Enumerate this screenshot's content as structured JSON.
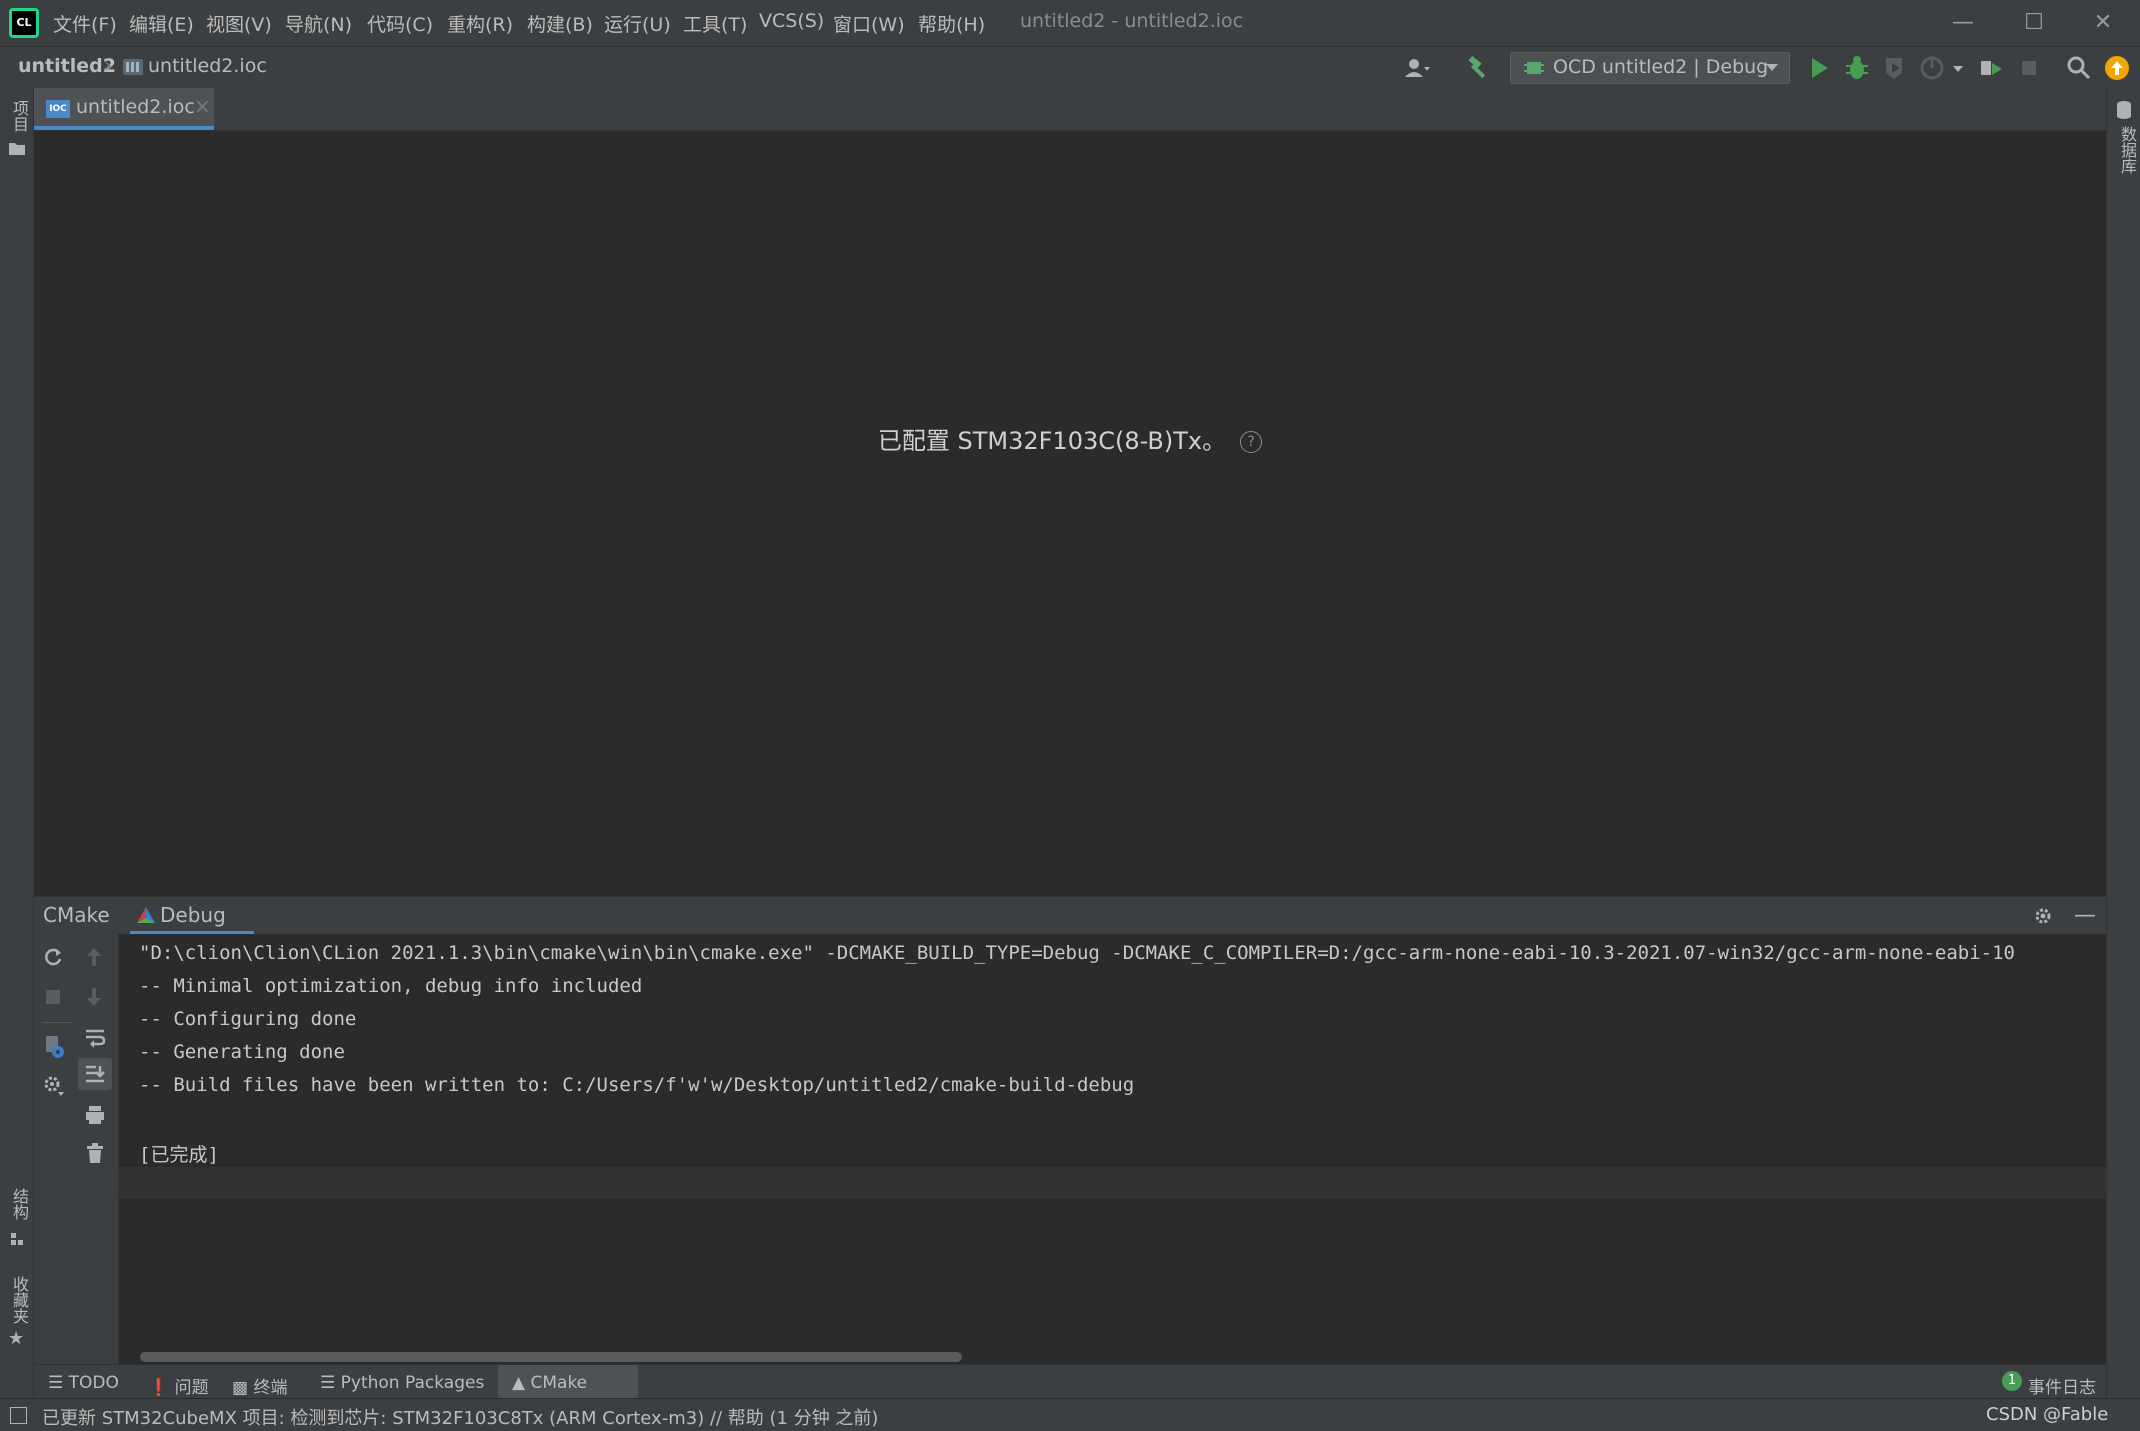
{
  "window": {
    "title": "untitled2 - untitled2.ioc",
    "app_icon_text": "CL"
  },
  "menu": [
    "文件(F)",
    "编辑(E)",
    "视图(V)",
    "导航(N)",
    "代码(C)",
    "重构(R)",
    "构建(B)",
    "运行(U)",
    "工具(T)",
    "VCS(S)",
    "窗口(W)",
    "帮助(H)"
  ],
  "navbar": {
    "project": "untitled2",
    "file": "untitled2.ioc",
    "run_config": "OCD untitled2 | Debug"
  },
  "left_stripe": {
    "project_label": "项目",
    "structure_label": "结构",
    "favorites_label": "收藏夹"
  },
  "right_stripe": {
    "database_label": "数据库"
  },
  "editor": {
    "tab_label": "untitled2.ioc",
    "tab_icon_text": "IOC",
    "message": "已配置 STM32F103C(8-B)Tx。",
    "help_glyph": "?"
  },
  "tool_window": {
    "title": "CMake",
    "tab": "Debug",
    "console_lines": [
      "\"D:\\clion\\Clion\\CLion 2021.1.3\\bin\\cmake\\win\\bin\\cmake.exe\" -DCMAKE_BUILD_TYPE=Debug -DCMAKE_C_COMPILER=D:/gcc-arm-none-eabi-10.3-2021.07-win32/gcc-arm-none-eabi-10",
      "-- Minimal optimization, debug info included",
      "-- Configuring done",
      "-- Generating done",
      "-- Build files have been written to: C:/Users/f'w'w/Desktop/untitled2/cmake-build-debug",
      "",
      "[已完成]"
    ]
  },
  "bottom_tabs": [
    "TODO",
    "问题",
    "终端",
    "Python Packages",
    "CMake"
  ],
  "event_log": {
    "count": "1",
    "label": "事件日志"
  },
  "status": {
    "text": "已更新 STM32CubeMX 项目: 检测到芯片: STM32F103C8Tx (ARM Cortex-m3) // 帮助 (1 分钟 之前)",
    "watermark": "CSDN @Fable"
  },
  "colors": {
    "accent": "#4a88c7",
    "run_green": "#499c54",
    "build_green": "#59a869",
    "update_orange": "#f2a500"
  }
}
